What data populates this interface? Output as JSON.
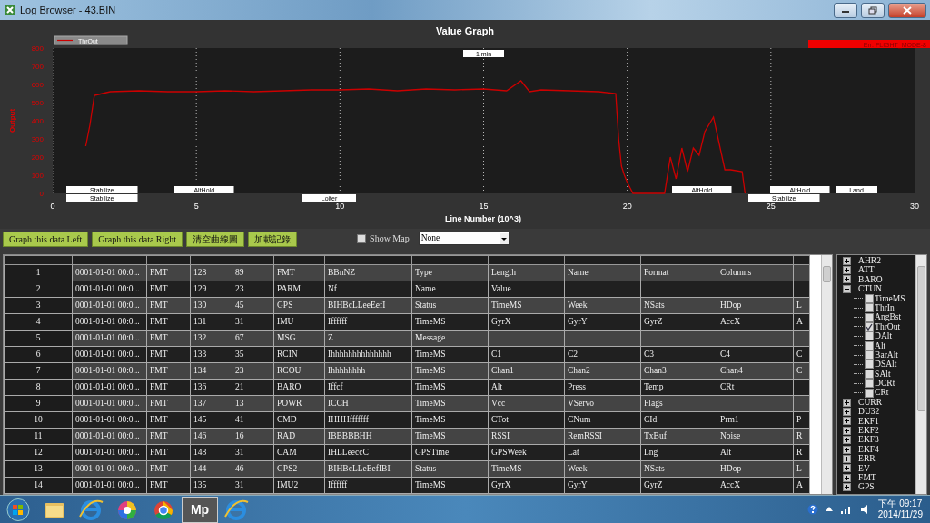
{
  "window": {
    "title": "Log Browser - 43.BIN"
  },
  "graph": {
    "title": "Value Graph",
    "error_banner": "Err: FLIGHT_MODE-8",
    "scale_label": "1 min",
    "chart_data": {
      "type": "line",
      "xlabel": "Line Number (10^3)",
      "ylabel": "Output",
      "x": [
        1.15,
        1.3,
        1.45,
        1.6,
        2,
        3,
        4,
        5,
        6,
        7,
        8,
        9,
        10,
        11,
        12,
        13,
        14,
        15,
        15.8,
        16.3,
        16.6,
        17,
        18,
        19,
        19.6,
        19.7,
        19.8,
        19.9,
        20,
        20.2,
        21.3,
        21.5,
        21.7,
        21.9,
        22.1,
        22.3,
        22.5,
        22.7,
        23,
        23.4,
        23.6,
        24,
        24.1
      ],
      "series": [
        {
          "name": "ThrOut",
          "color": "#cc0000",
          "values": [
            260,
            380,
            540,
            545,
            560,
            565,
            560,
            560,
            565,
            560,
            565,
            570,
            570,
            575,
            565,
            575,
            570,
            575,
            565,
            620,
            560,
            570,
            565,
            560,
            550,
            300,
            150,
            100,
            60,
            0,
            0,
            200,
            80,
            250,
            120,
            250,
            210,
            340,
            420,
            130,
            130,
            120,
            0
          ]
        }
      ],
      "grid": true,
      "xlim": [
        0,
        30
      ],
      "ylim": [
        0,
        800
      ],
      "xticks": [
        0,
        5,
        10,
        15,
        20,
        25,
        30
      ],
      "yticks": [
        0,
        100,
        200,
        300,
        400,
        500,
        600,
        700,
        800
      ]
    },
    "flight_modes": [
      "Stabilize",
      "AltHold",
      "AltHold",
      "AltHold",
      "Land",
      "Stabilize",
      "Loiter",
      "Stabilize"
    ]
  },
  "toolbar": {
    "buttons": [
      "Graph this data Left",
      "Graph this data Right",
      "清空曲線圖",
      "加載記錄"
    ],
    "show_map": {
      "label": "Show Map",
      "checked": false
    },
    "map_select": {
      "value": "None"
    }
  },
  "table": {
    "rows": [
      {
        "index": "1",
        "cells": [
          "0001-01-01 00:0...",
          "FMT",
          "128",
          "89",
          "FMT",
          "BBnNZ",
          "Type",
          "Length",
          "Name",
          "Format",
          "Columns",
          null
        ]
      },
      {
        "index": "2",
        "cells": [
          "0001-01-01 00:0...",
          "FMT",
          "129",
          "23",
          "PARM",
          "Nf",
          "Name",
          "Value",
          null,
          null,
          null,
          null
        ]
      },
      {
        "index": "3",
        "cells": [
          "0001-01-01 00:0...",
          "FMT",
          "130",
          "45",
          "GPS",
          "BIHBcLLeeEefI",
          "Status",
          "TimeMS",
          "Week",
          "NSats",
          "HDop",
          "L"
        ]
      },
      {
        "index": "4",
        "cells": [
          "0001-01-01 00:0...",
          "FMT",
          "131",
          "31",
          "IMU",
          "Iffffff",
          "TimeMS",
          "GyrX",
          "GyrY",
          "GyrZ",
          "AccX",
          "A"
        ]
      },
      {
        "index": "5",
        "cells": [
          "0001-01-01 00:0...",
          "FMT",
          "132",
          "67",
          "MSG",
          "Z",
          "Message",
          null,
          null,
          null,
          null,
          null
        ]
      },
      {
        "index": "6",
        "cells": [
          "0001-01-01 00:0...",
          "FMT",
          "133",
          "35",
          "RCIN",
          "Ihhhhhhhhhhhhhh",
          "TimeMS",
          "C1",
          "C2",
          "C3",
          "C4",
          "C"
        ]
      },
      {
        "index": "7",
        "cells": [
          "0001-01-01 00:0...",
          "FMT",
          "134",
          "23",
          "RCOU",
          "Ihhhhhhhh",
          "TimeMS",
          "Chan1",
          "Chan2",
          "Chan3",
          "Chan4",
          "C"
        ]
      },
      {
        "index": "8",
        "cells": [
          "0001-01-01 00:0...",
          "FMT",
          "136",
          "21",
          "BARO",
          "Iffcf",
          "TimeMS",
          "Alt",
          "Press",
          "Temp",
          "CRt",
          null
        ]
      },
      {
        "index": "9",
        "cells": [
          "0001-01-01 00:0...",
          "FMT",
          "137",
          "13",
          "POWR",
          "ICCH",
          "TimeMS",
          "Vcc",
          "VServo",
          "Flags",
          null,
          null
        ]
      },
      {
        "index": "10",
        "cells": [
          "0001-01-01 00:0...",
          "FMT",
          "145",
          "41",
          "CMD",
          "IHHHfffffff",
          "TimeMS",
          "CTot",
          "CNum",
          "CId",
          "Prm1",
          "P"
        ]
      },
      {
        "index": "11",
        "cells": [
          "0001-01-01 00:0...",
          "FMT",
          "146",
          "16",
          "RAD",
          "IBBBBBHH",
          "TimeMS",
          "RSSI",
          "RemRSSI",
          "TxBuf",
          "Noise",
          "R"
        ]
      },
      {
        "index": "12",
        "cells": [
          "0001-01-01 00:0...",
          "FMT",
          "148",
          "31",
          "CAM",
          "IHLLeeccC",
          "GPSTime",
          "GPSWeek",
          "Lat",
          "Lng",
          "Alt",
          "R"
        ]
      },
      {
        "index": "13",
        "cells": [
          "0001-01-01 00:0...",
          "FMT",
          "144",
          "46",
          "GPS2",
          "BIHBcLLeEefIBI",
          "Status",
          "TimeMS",
          "Week",
          "NSats",
          "HDop",
          "L"
        ]
      },
      {
        "index": "14",
        "cells": [
          "0001-01-01 00:0...",
          "FMT",
          "135",
          "31",
          "IMU2",
          "Iffffff",
          "TimeMS",
          "GyrX",
          "GyrY",
          "GyrZ",
          "AccX",
          "A"
        ]
      }
    ]
  },
  "tree": [
    {
      "label": "AHR2",
      "expanded": false
    },
    {
      "label": "ATT",
      "expanded": false
    },
    {
      "label": "BARO",
      "expanded": false
    },
    {
      "label": "CTUN",
      "expanded": true,
      "children": [
        {
          "label": "TimeMS",
          "checked": false
        },
        {
          "label": "ThrIn",
          "checked": false
        },
        {
          "label": "AngBst",
          "checked": false
        },
        {
          "label": "ThrOut",
          "checked": true
        },
        {
          "label": "DAlt",
          "checked": false
        },
        {
          "label": "Alt",
          "checked": false
        },
        {
          "label": "BarAlt",
          "checked": false
        },
        {
          "label": "DSAlt",
          "checked": false
        },
        {
          "label": "SAlt",
          "checked": false
        },
        {
          "label": "DCRt",
          "checked": false
        },
        {
          "label": "CRt",
          "checked": false
        }
      ]
    },
    {
      "label": "CURR",
      "expanded": false
    },
    {
      "label": "DU32",
      "expanded": false
    },
    {
      "label": "EKF1",
      "expanded": false
    },
    {
      "label": "EKF2",
      "expanded": false
    },
    {
      "label": "EKF3",
      "expanded": false
    },
    {
      "label": "EKF4",
      "expanded": false
    },
    {
      "label": "ERR",
      "expanded": false
    },
    {
      "label": "EV",
      "expanded": false
    },
    {
      "label": "FMT",
      "expanded": false
    },
    {
      "label": "GPS",
      "expanded": false
    }
  ],
  "taskbar": {
    "apps": [
      {
        "kind": "folder"
      },
      {
        "kind": "ie"
      },
      {
        "kind": "wheel"
      },
      {
        "kind": "chrome"
      },
      {
        "kind": "text",
        "label": "Mp"
      },
      {
        "kind": "ie"
      }
    ],
    "time": "下午 09:17",
    "date": "2014/11/29"
  }
}
